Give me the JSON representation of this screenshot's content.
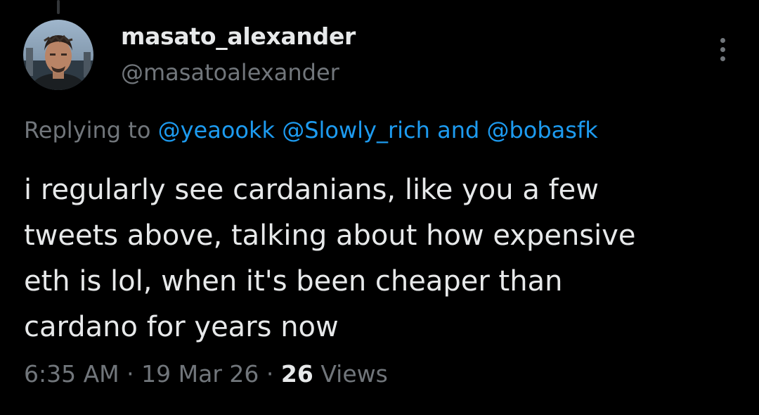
{
  "tweet": {
    "author": {
      "display_name": "masato_alexander",
      "handle": "@masatoalexander",
      "avatar_icon": "profile-photo"
    },
    "more_icon": "more-vertical-icon",
    "replying": {
      "prefix": "Replying to",
      "mentions": [
        "@yeaookk",
        "@Slowly_rich",
        "@bobasfk"
      ],
      "conjunction": "and"
    },
    "text_lines": [
      "i regularly see cardanians, like you a few",
      "tweets above, talking about how expensive",
      "eth is lol, when it's been cheaper than",
      "cardano for years now"
    ],
    "meta": {
      "time": "6:35 AM",
      "separator": "·",
      "date": "19 Mar 26",
      "views_count": "26",
      "views_label": "Views"
    }
  },
  "colors": {
    "background": "#000000",
    "primary_text": "#e7e9ea",
    "secondary_text": "#71767b",
    "link": "#1d9bf0"
  }
}
